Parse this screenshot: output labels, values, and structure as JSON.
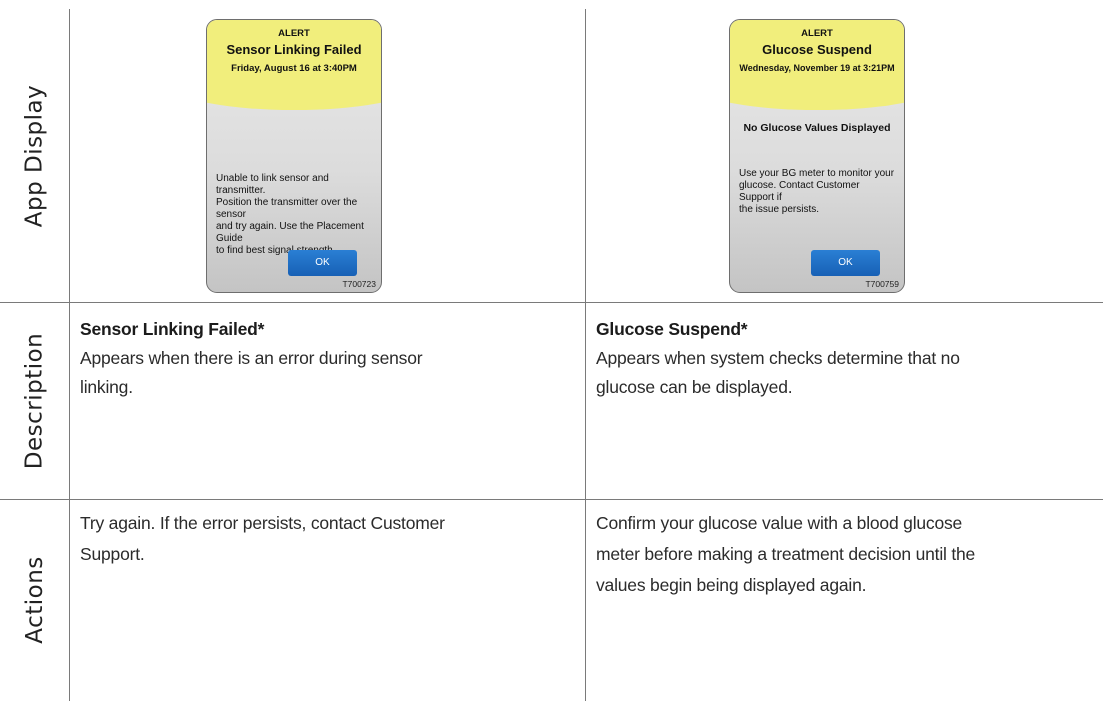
{
  "row_labels": {
    "app_display": "App Display",
    "description": "Description",
    "actions": "Actions"
  },
  "alerts": [
    {
      "kicker": "ALERT",
      "title": "Sensor Linking Failed",
      "date": "Friday, August 16 at 3:40PM",
      "subhead": "",
      "message_lines": [
        "Unable to link sensor and transmitter.",
        "Position the transmitter over the sensor",
        "and try again. Use the Placement Guide",
        "to find best signal strength."
      ],
      "button": "OK",
      "code": "T700723"
    },
    {
      "kicker": "ALERT",
      "title": "Glucose Suspend",
      "date": "Wednesday, November 19 at 3:21PM",
      "subhead": "No Glucose Values Displayed",
      "message_lines": [
        "Use your BG meter to monitor your",
        "glucose. Contact Customer Support if",
        "the issue persists."
      ],
      "button": "OK",
      "code": "T700759"
    }
  ],
  "descriptions": [
    {
      "heading": "Sensor Linking Failed*",
      "lines": [
        "Appears when there is an error during sensor",
        "linking."
      ]
    },
    {
      "heading": "Glucose Suspend*",
      "lines": [
        "Appears when system checks determine that no",
        "glucose can be displayed."
      ]
    }
  ],
  "actions": [
    {
      "lines": [
        "Try again. If the error persists, contact Customer",
        "Support."
      ]
    },
    {
      "lines": [
        "Confirm your glucose value with a blood glucose",
        "meter before making a treatment decision until the",
        "values begin being displayed again."
      ]
    }
  ],
  "colors": {
    "alert_banner": "#f1ee7c",
    "ok_button": "#1f6fc8",
    "grid_line": "#7a7a7a"
  }
}
